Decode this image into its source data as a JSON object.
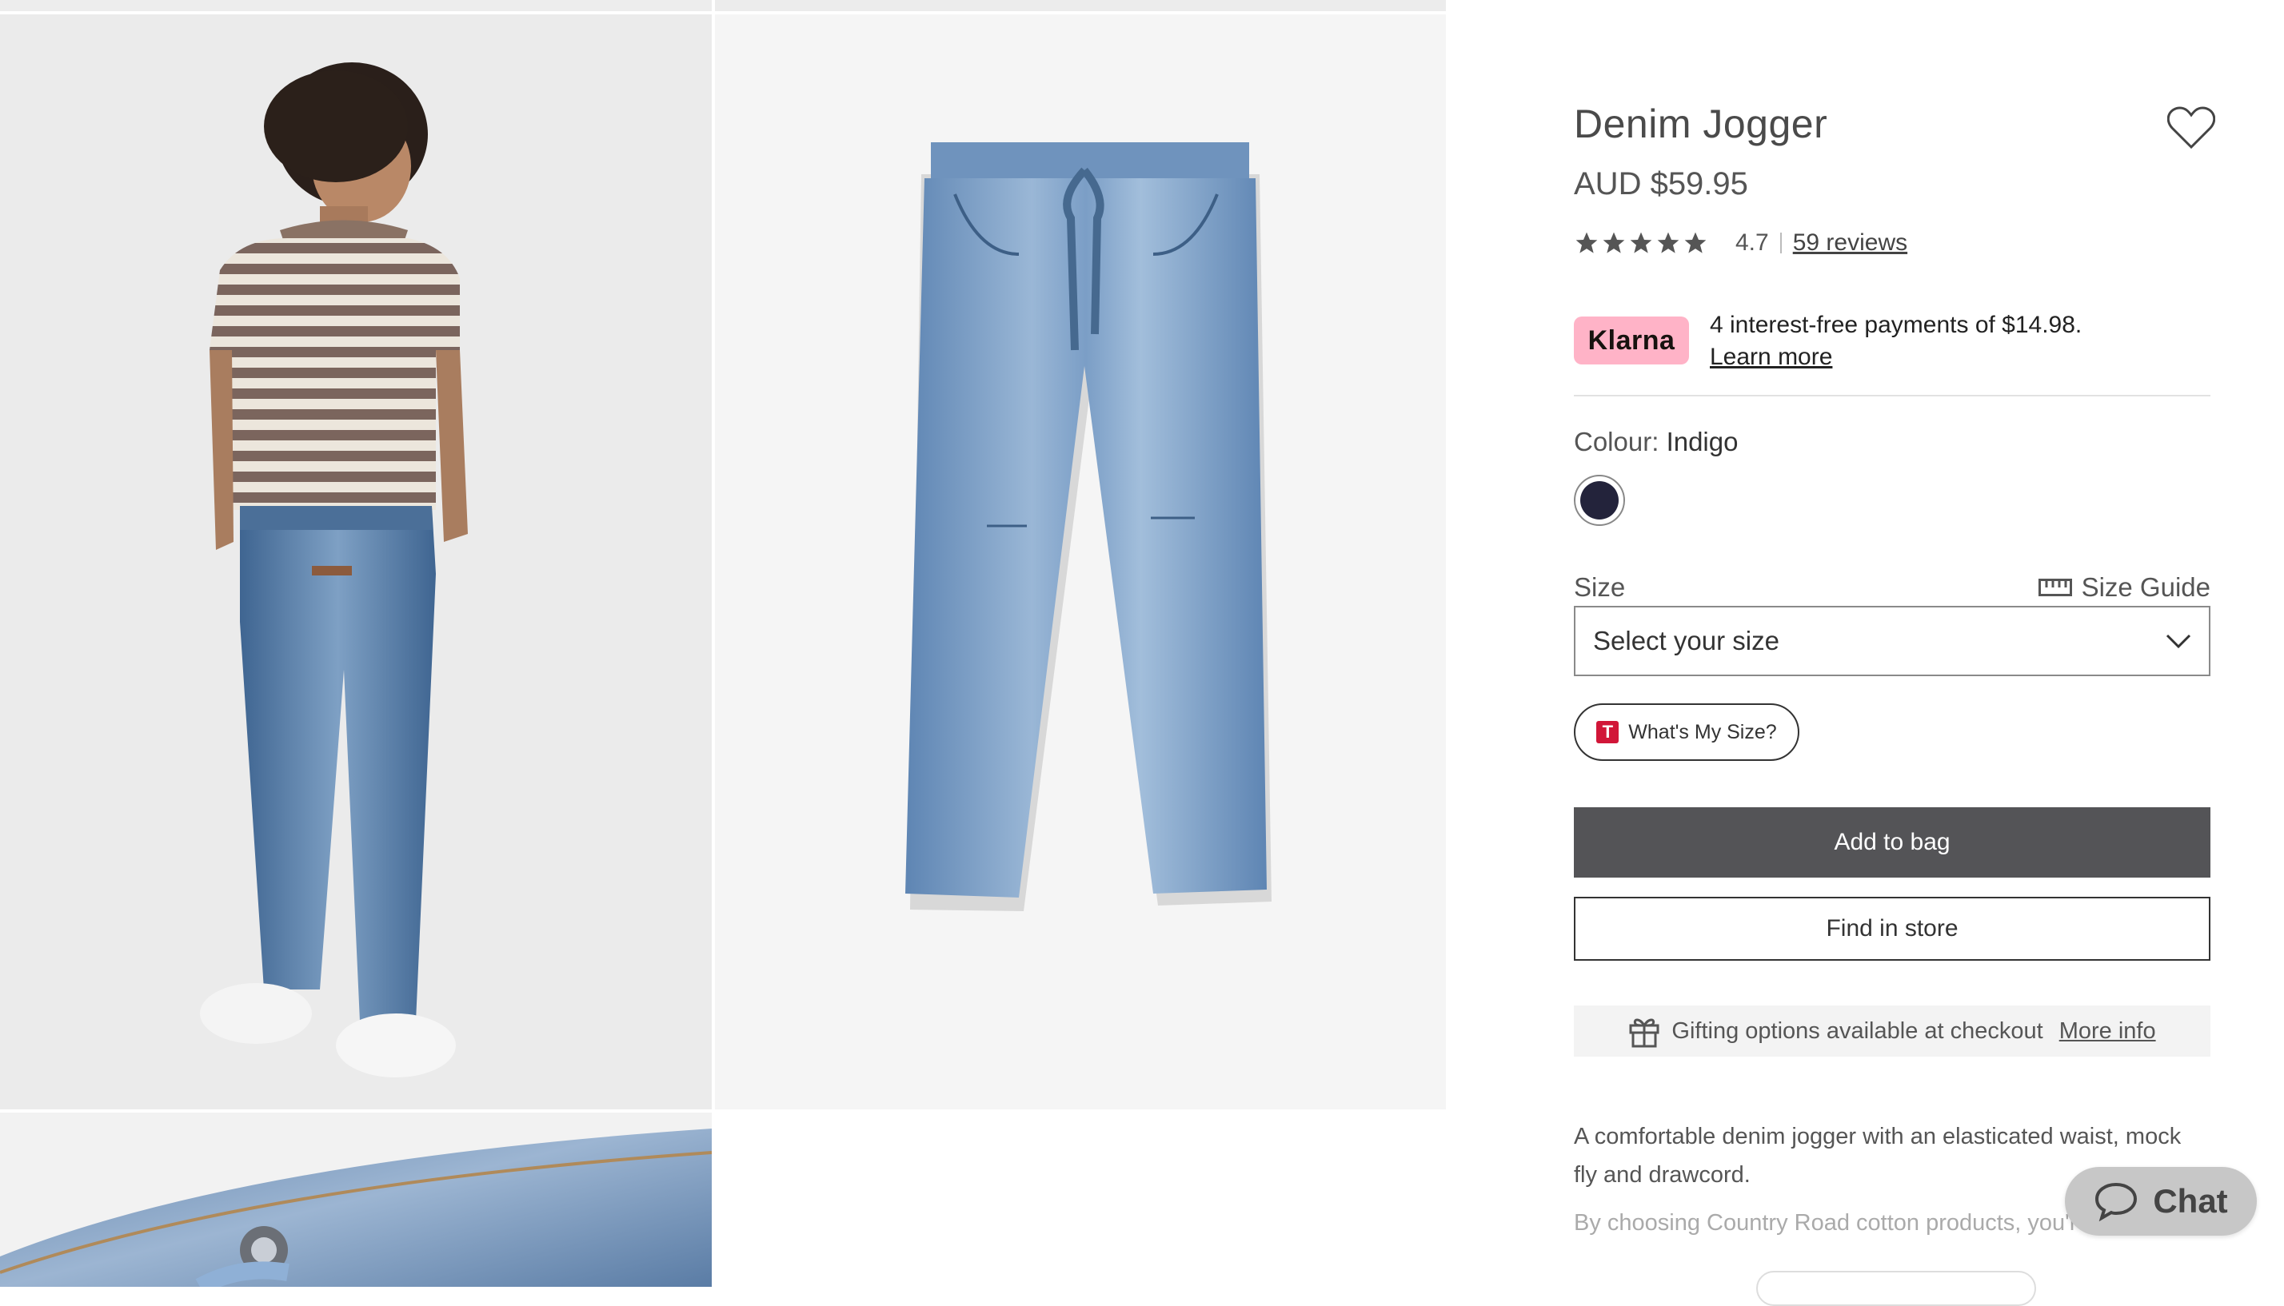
{
  "product": {
    "title": "Denim Jogger",
    "price": "AUD $59.95",
    "rating_value": "4.7",
    "rating_stars": 4.7,
    "reviews_label": "59 reviews"
  },
  "klarna": {
    "badge": "Klarna",
    "text": "4 interest-free payments of $14.98.",
    "learn_more": "Learn more",
    "brand_color": "#ffb3c7"
  },
  "colour": {
    "label": "Colour:",
    "value": "Indigo",
    "swatch_color": "#23233b"
  },
  "size": {
    "label": "Size",
    "guide_label": "Size Guide",
    "placeholder": "Select your size",
    "whats_my_size": "What's My Size?",
    "whats_my_size_logo": "T"
  },
  "actions": {
    "add_to_bag": "Add to bag",
    "find_in_store": "Find in store"
  },
  "gifting": {
    "text": "Gifting options available at checkout",
    "more_info": "More info"
  },
  "description": {
    "text": "A comfortable denim jogger with an elasticated waist, mock fly and drawcord.",
    "sustainability_text": "By choosing Country Road cotton products, you're"
  },
  "chat": {
    "label": "Chat"
  },
  "icons": {
    "wishlist": "heart-icon",
    "star": "star-icon",
    "size_guide": "ruler-icon",
    "dropdown": "chevron-down-icon",
    "gift": "gift-icon",
    "chat": "chat-bubble-icon"
  },
  "colors": {
    "add_to_bag_bg": "#545457",
    "chat_bg": "#c7c7c7"
  }
}
